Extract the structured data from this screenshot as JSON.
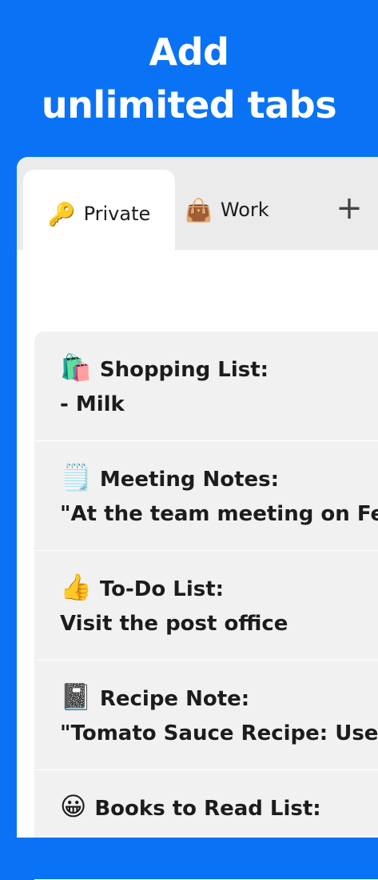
{
  "headline": {
    "line1": "Add",
    "line2": "unlimited tabs"
  },
  "tabs": [
    {
      "emoji": "🔑",
      "label": "Private",
      "active": true
    },
    {
      "emoji": "👜",
      "label": "Work",
      "active": false
    }
  ],
  "add_tab_label": "+",
  "notes": [
    {
      "emoji": "🛍️",
      "title": "Shopping List:",
      "body": "- Milk"
    },
    {
      "emoji": "🗒️",
      "title": "Meeting Notes:",
      "body": "\"At the team meeting on Fe"
    },
    {
      "emoji": "👍",
      "title": "To-Do List:",
      "body": "Visit the post office"
    },
    {
      "emoji": "📓",
      "title": "Recipe Note:",
      "body": "\"Tomato Sauce Recipe: Use"
    },
    {
      "emoji": "😀",
      "title": "Books to Read List:",
      "body": ""
    }
  ],
  "colors": {
    "background": "#0a72f5",
    "tabbar": "#ebebeb",
    "notes_bg": "#f1f1f1"
  }
}
